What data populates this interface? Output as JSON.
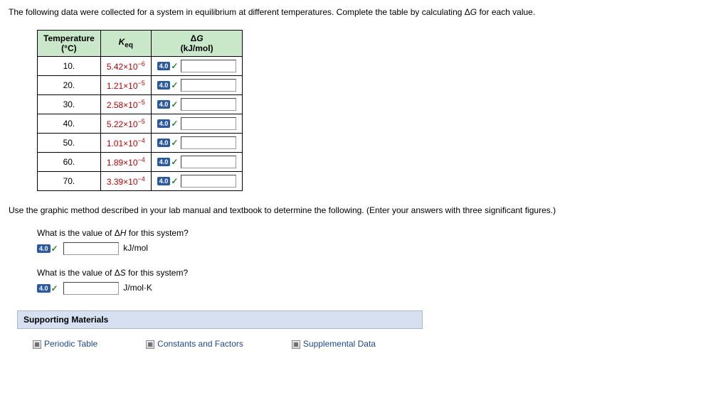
{
  "instruction": "The following data were collected for a system in equilibrium at different temperatures. Complete the table by calculating ΔG for each value.",
  "table": {
    "headers": {
      "temp": "Temperature",
      "temp_unit": "(°C)",
      "keq": "K",
      "keq_sub": "eq",
      "dg": "ΔG",
      "dg_unit": "(kJ/mol)"
    },
    "rows": [
      {
        "temp": "10.",
        "keq_base": "5.42",
        "keq_exp": "−6",
        "points": "4.0"
      },
      {
        "temp": "20.",
        "keq_base": "1.21",
        "keq_exp": "−5",
        "points": "4.0"
      },
      {
        "temp": "30.",
        "keq_base": "2.58",
        "keq_exp": "−5",
        "points": "4.0"
      },
      {
        "temp": "40.",
        "keq_base": "5.22",
        "keq_exp": "−5",
        "points": "4.0"
      },
      {
        "temp": "50.",
        "keq_base": "1.01",
        "keq_exp": "−4",
        "points": "4.0"
      },
      {
        "temp": "60.",
        "keq_base": "1.89",
        "keq_exp": "−4",
        "points": "4.0"
      },
      {
        "temp": "70.",
        "keq_base": "3.39",
        "keq_exp": "−4",
        "points": "4.0"
      }
    ]
  },
  "instruction2": "Use the graphic method described in your lab manual and textbook to determine the following. (Enter your answers with three significant figures.)",
  "q_dh": {
    "prompt": "What is the value of ΔH for this system?",
    "points": "4.0",
    "unit": "kJ/mol"
  },
  "q_ds": {
    "prompt": "What is the value of ΔS for this system?",
    "points": "4.0",
    "unit": "J/mol·K"
  },
  "supporting": {
    "header": "Supporting Materials",
    "links": {
      "periodic": "Periodic Table",
      "constants": "Constants and Factors",
      "supplemental": "Supplemental Data"
    }
  }
}
